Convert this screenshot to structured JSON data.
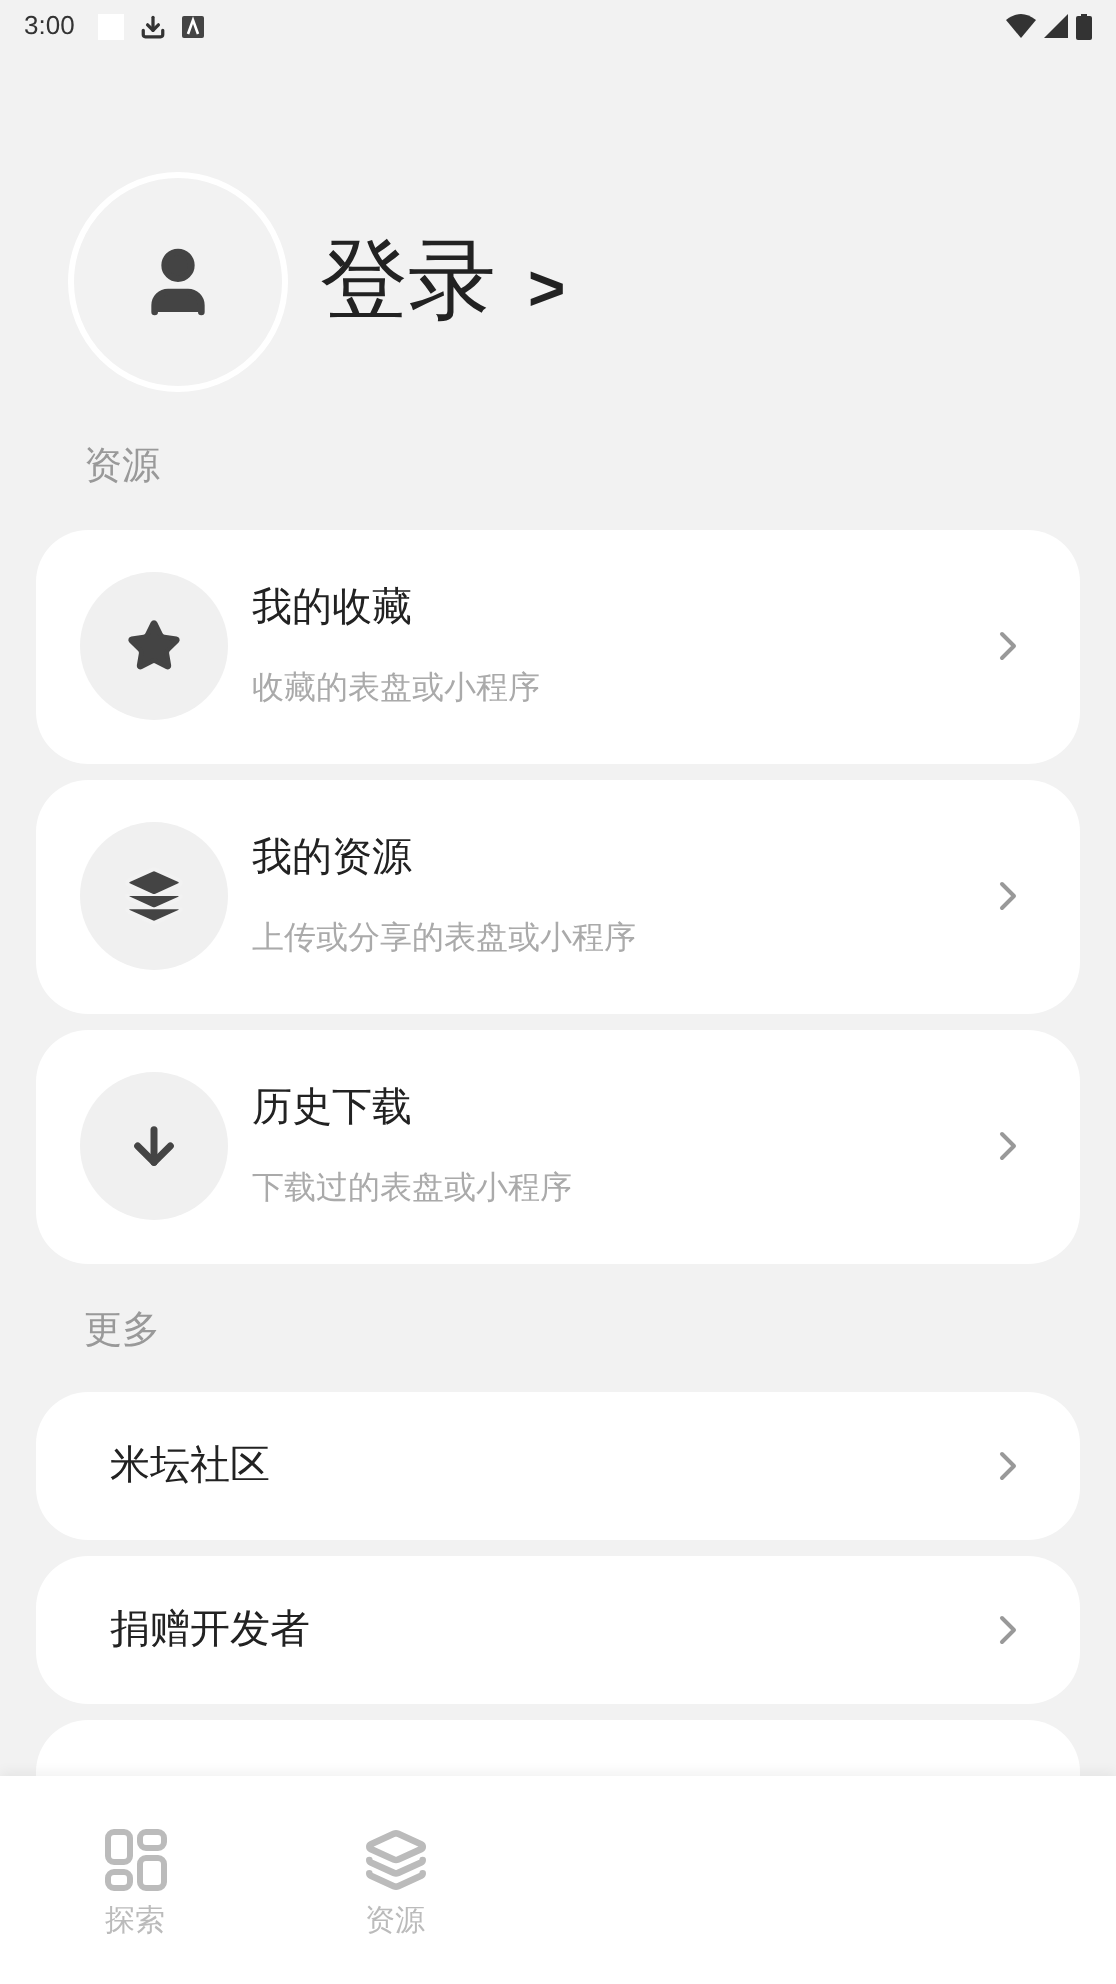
{
  "status_bar": {
    "time": "3:00"
  },
  "profile": {
    "login": "登录",
    "arrow": ">"
  },
  "sections": [
    {
      "title": "资源",
      "items": [
        {
          "kind": "icon",
          "title": "我的收藏",
          "subtitle": "收藏的表盘或小程序"
        },
        {
          "kind": "icon",
          "title": "我的资源",
          "subtitle": "上传或分享的表盘或小程序"
        },
        {
          "kind": "icon",
          "title": "历史下载",
          "subtitle": "下载过的表盘或小程序"
        }
      ]
    },
    {
      "title": "更多",
      "items": [
        {
          "kind": "plain",
          "title": "米坛社区"
        },
        {
          "kind": "plain",
          "title": "捐赠开发者"
        }
      ]
    }
  ],
  "bottom_nav": [
    {
      "label": "探索",
      "selected": false
    },
    {
      "label": "资源",
      "selected": false
    }
  ]
}
